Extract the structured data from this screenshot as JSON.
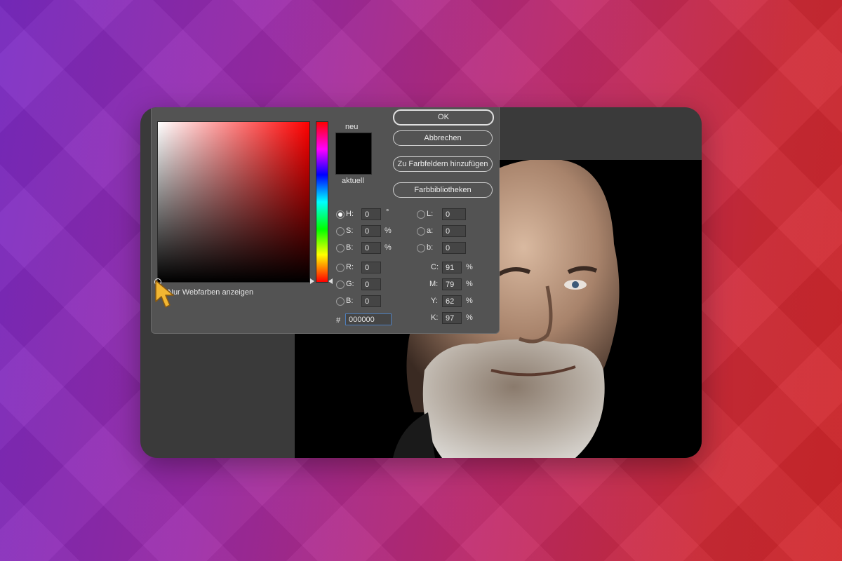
{
  "dialog": {
    "new_label": "neu",
    "current_label": "aktuell",
    "buttons": {
      "ok": "OK",
      "cancel": "Abbrechen",
      "add_swatch": "Zu Farbfeldern hinzufügen",
      "libraries": "Farbbibliotheken"
    },
    "hsb": {
      "h": {
        "label": "H:",
        "value": "0",
        "unit": "°",
        "selected": true
      },
      "s": {
        "label": "S:",
        "value": "0",
        "unit": "%"
      },
      "b": {
        "label": "B:",
        "value": "0",
        "unit": "%"
      }
    },
    "rgb": {
      "r": {
        "label": "R:",
        "value": "0"
      },
      "g": {
        "label": "G:",
        "value": "0"
      },
      "b": {
        "label": "B:",
        "value": "0"
      }
    },
    "lab": {
      "l": {
        "label": "L:",
        "value": "0"
      },
      "a": {
        "label": "a:",
        "value": "0"
      },
      "b": {
        "label": "b:",
        "value": "0"
      }
    },
    "cmyk": {
      "c": {
        "label": "C:",
        "value": "91",
        "unit": "%"
      },
      "m": {
        "label": "M:",
        "value": "79",
        "unit": "%"
      },
      "y": {
        "label": "Y:",
        "value": "62",
        "unit": "%"
      },
      "k": {
        "label": "K:",
        "value": "97",
        "unit": "%"
      }
    },
    "hex": {
      "label": "#",
      "value": "000000"
    },
    "web_colors_label": "Nur Webfarben anzeigen"
  },
  "colors": {
    "new_color": "#000000",
    "current_color": "#000000",
    "background_from": "#7a2bc4",
    "background_to": "#d0262a",
    "cursor": "#f2b632"
  }
}
